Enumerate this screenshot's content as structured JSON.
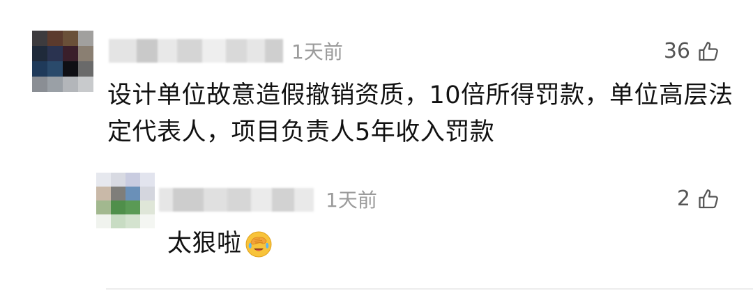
{
  "comments": [
    {
      "time": "1天前",
      "likes": "36",
      "content": "设计单位故意造假撤销资质，10倍所得罚款，单位高层法定代表人，项目负责人5年收入罚款"
    },
    {
      "time": "1天前",
      "likes": "2",
      "content": "太狠啦"
    }
  ],
  "icons": {
    "like": "thumbs-up-icon",
    "emoji": "face-with-tears-covering-eyes-emoji"
  },
  "colors": {
    "time_text": "#9b9b9b",
    "like_text": "#555555",
    "body_text": "#111111",
    "divider": "#ececec"
  }
}
